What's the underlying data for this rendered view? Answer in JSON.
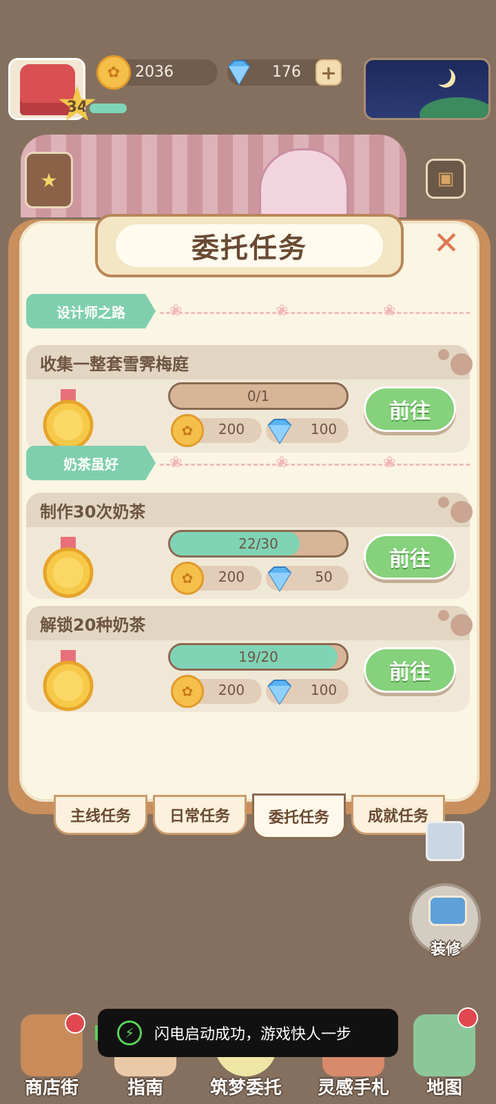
{
  "hud": {
    "level": "34",
    "coins": "2036",
    "gems": "176"
  },
  "modal": {
    "title": "委托任务",
    "sections": [
      {
        "label": "设计师之路",
        "tasks": [
          {
            "title": "收集一整套雪霁梅庭",
            "progress_text": "0/1",
            "progress_fraction": 0,
            "coin_reward": "200",
            "gem_reward": "100",
            "button": "前往"
          }
        ]
      },
      {
        "label": "奶茶虽好",
        "tasks": [
          {
            "title": "制作30次奶茶",
            "progress_text": "22/30",
            "progress_fraction": 0.733,
            "coin_reward": "200",
            "gem_reward": "50",
            "button": "前往"
          },
          {
            "title": "解锁20种奶茶",
            "progress_text": "19/20",
            "progress_fraction": 0.95,
            "coin_reward": "200",
            "gem_reward": "100",
            "button": "前往"
          }
        ]
      }
    ],
    "tabs": [
      {
        "label": "主线任务",
        "active": false
      },
      {
        "label": "日常任务",
        "active": false
      },
      {
        "label": "委托任务",
        "active": true
      },
      {
        "label": "成就任务",
        "active": false
      }
    ]
  },
  "side": {
    "decorate_label": "装修"
  },
  "bottom_nav": [
    {
      "label": "商店街",
      "icon": "shop-icon",
      "badge": true
    },
    {
      "label": "指南",
      "icon": "guide-icon",
      "badge": false
    },
    {
      "label": "筑梦委托",
      "icon": "commission-icon",
      "badge": false
    },
    {
      "label": "灵感手札",
      "icon": "notebook-icon",
      "badge": false
    },
    {
      "label": "地图",
      "icon": "map-icon",
      "badge": true
    }
  ],
  "toast": {
    "message": "闪电启动成功，游戏快人一步"
  },
  "colors": {
    "accent_green": "#86d17c",
    "progress_teal": "#7fd4b6",
    "section_tag": "#7fcfae",
    "close_orange": "#dc7a55"
  }
}
